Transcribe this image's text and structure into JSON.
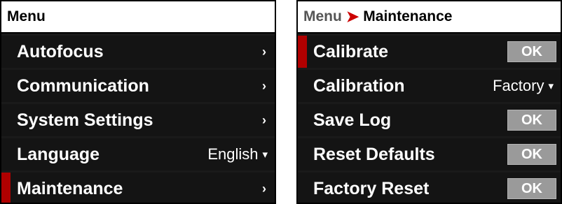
{
  "left": {
    "header": "Menu",
    "items": [
      {
        "label": "Autofocus",
        "indicator": "›"
      },
      {
        "label": "Communication",
        "indicator": "›"
      },
      {
        "label": "System Settings",
        "indicator": "›"
      },
      {
        "label": "Language",
        "value": "English",
        "indicator": "▾"
      },
      {
        "label": "Maintenance",
        "indicator": "›"
      }
    ]
  },
  "right": {
    "breadcrumb": {
      "root": "Menu",
      "separator": "➤",
      "current": "Maintenance"
    },
    "items": [
      {
        "label": "Calibrate",
        "button": "OK"
      },
      {
        "label": "Calibration",
        "value": "Factory",
        "indicator": "▾"
      },
      {
        "label": "Save Log",
        "button": "OK"
      },
      {
        "label": "Reset Defaults",
        "button": "OK"
      },
      {
        "label": "Factory Reset",
        "button": "OK"
      }
    ]
  },
  "colors": {
    "selection": "#b00000",
    "button_bg": "#9a9a9a",
    "row_bg": "#141414",
    "breadcrumb_separator": "#cc0000"
  }
}
